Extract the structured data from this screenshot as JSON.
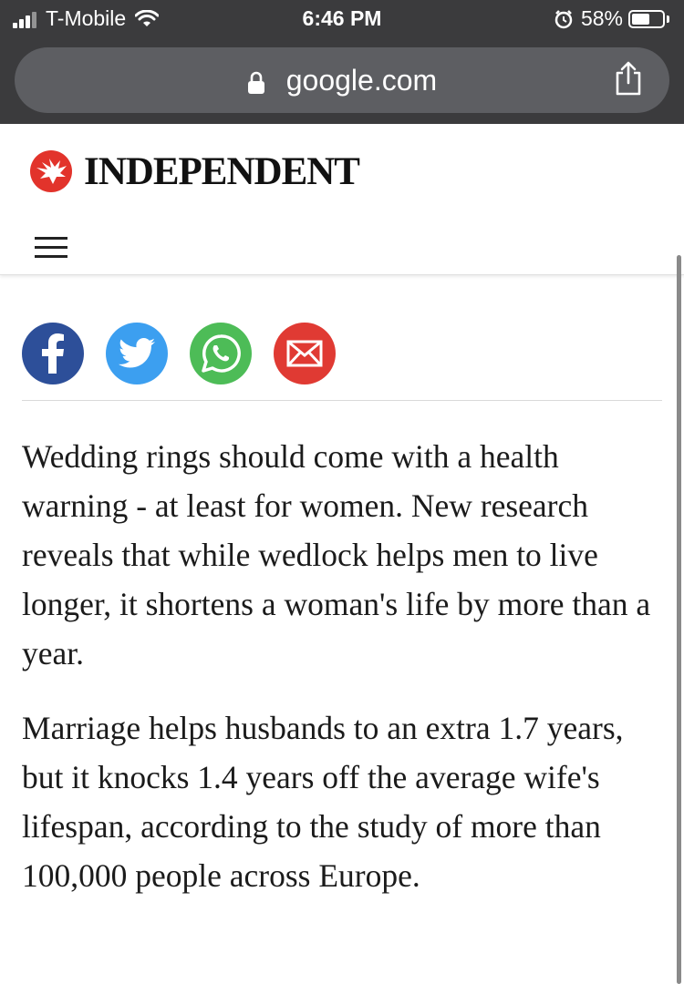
{
  "status_bar": {
    "carrier": "T-Mobile",
    "time": "6:46 PM",
    "battery_percent": "58%",
    "battery_level": 0.58,
    "icons": [
      "signal-icon",
      "wifi-icon",
      "alarm-icon",
      "battery-icon"
    ]
  },
  "browser": {
    "url": "google.com",
    "icons": [
      "lock-icon",
      "share-icon"
    ]
  },
  "site": {
    "logo_text": "INDEPENDENT",
    "icons": [
      "eagle-logo-icon",
      "hamburger-menu-icon"
    ]
  },
  "share_buttons": [
    {
      "name": "facebook",
      "color": "#2d4f99"
    },
    {
      "name": "twitter",
      "color": "#3c9ff0"
    },
    {
      "name": "whatsapp",
      "color": "#4dbc57"
    },
    {
      "name": "email",
      "color": "#e03a33"
    }
  ],
  "article": {
    "paragraphs": [
      "Wedding rings should come with a health warning - at least for women. New research reveals that while wedlock helps men to live longer, it shortens a woman's life by more than a year.",
      "Marriage helps husbands to an extra 1.7 years, but it knocks 1.4 years off the average wife's lifespan, according to the study of more than 100,000 people across Europe."
    ]
  }
}
